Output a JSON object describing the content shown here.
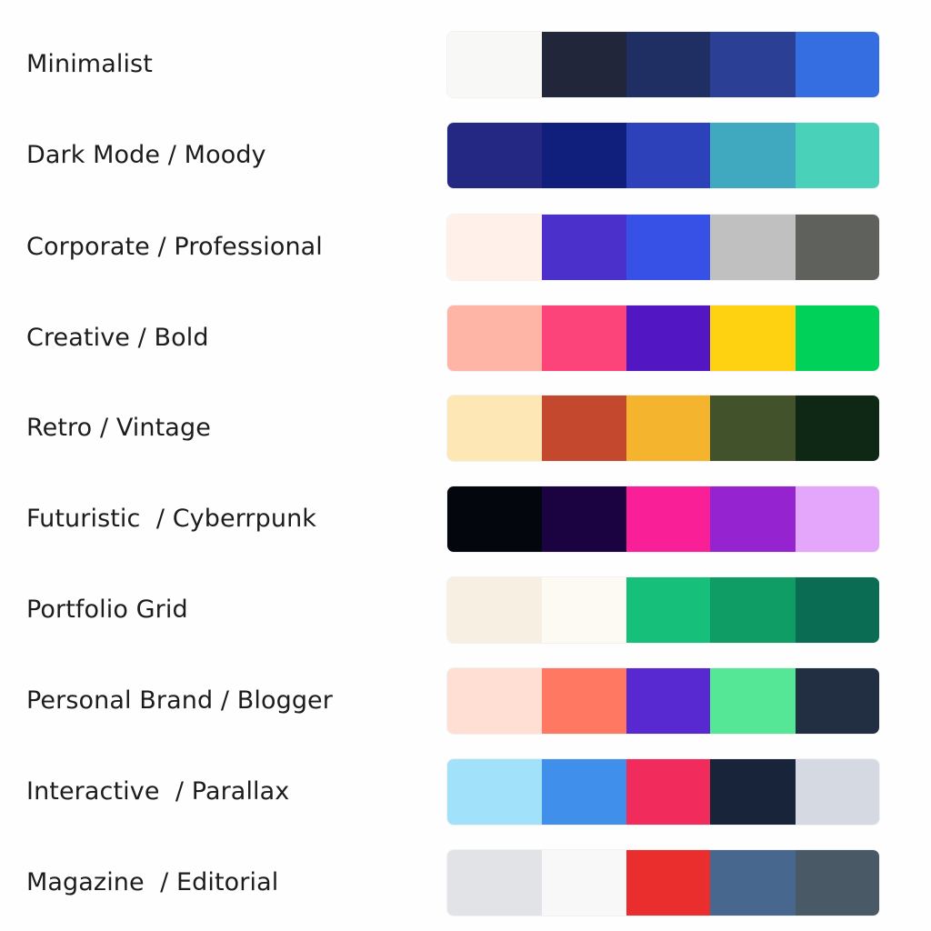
{
  "palettes": [
    {
      "label": "Minimalist",
      "colors": [
        "#f8f8f7",
        "#22263a",
        "#1f2f63",
        "#2b3f95",
        "#356ee0"
      ]
    },
    {
      "label": "Dark Mode / Moody",
      "colors": [
        "#242882",
        "#101f7c",
        "#2c41ba",
        "#40a8bf",
        "#49d1ba"
      ]
    },
    {
      "label": "Corporate / Professional",
      "colors": [
        "#fff1ea",
        "#4c30cc",
        "#3750e6",
        "#c0c0c0",
        "#5f615d"
      ]
    },
    {
      "label": "Creative / Bold",
      "colors": [
        "#ffb5a6",
        "#fc437a",
        "#5216c2",
        "#fed211",
        "#00d158"
      ]
    },
    {
      "label": "Retro / Vintage",
      "colors": [
        "#fde8b5",
        "#c3482d",
        "#f4b42e",
        "#42522a",
        "#0f2816"
      ]
    },
    {
      "label": "Futuristic  / Cyberrpunk",
      "colors": [
        "#04060d",
        "#1b0342",
        "#f91f97",
        "#9523cf",
        "#e3a6fa"
      ]
    },
    {
      "label": "Portfolio Grid",
      "colors": [
        "#f7efe2",
        "#fdfaf4",
        "#16c07a",
        "#0f9c65",
        "#096c53"
      ]
    },
    {
      "label": "Personal Brand / Blogger",
      "colors": [
        "#ffdfd3",
        "#ff7862",
        "#5828d1",
        "#56e796",
        "#222e42"
      ]
    },
    {
      "label": "Interactive  / Parallax",
      "colors": [
        "#a1e1fa",
        "#3f8feb",
        "#f12c5d",
        "#18243a",
        "#d5dae2"
      ]
    },
    {
      "label": "Magazine  / Editorial",
      "colors": [
        "#e1e3e6",
        "#f8f8f9",
        "#ea2d2d",
        "#48678f",
        "#4a5966"
      ]
    }
  ]
}
